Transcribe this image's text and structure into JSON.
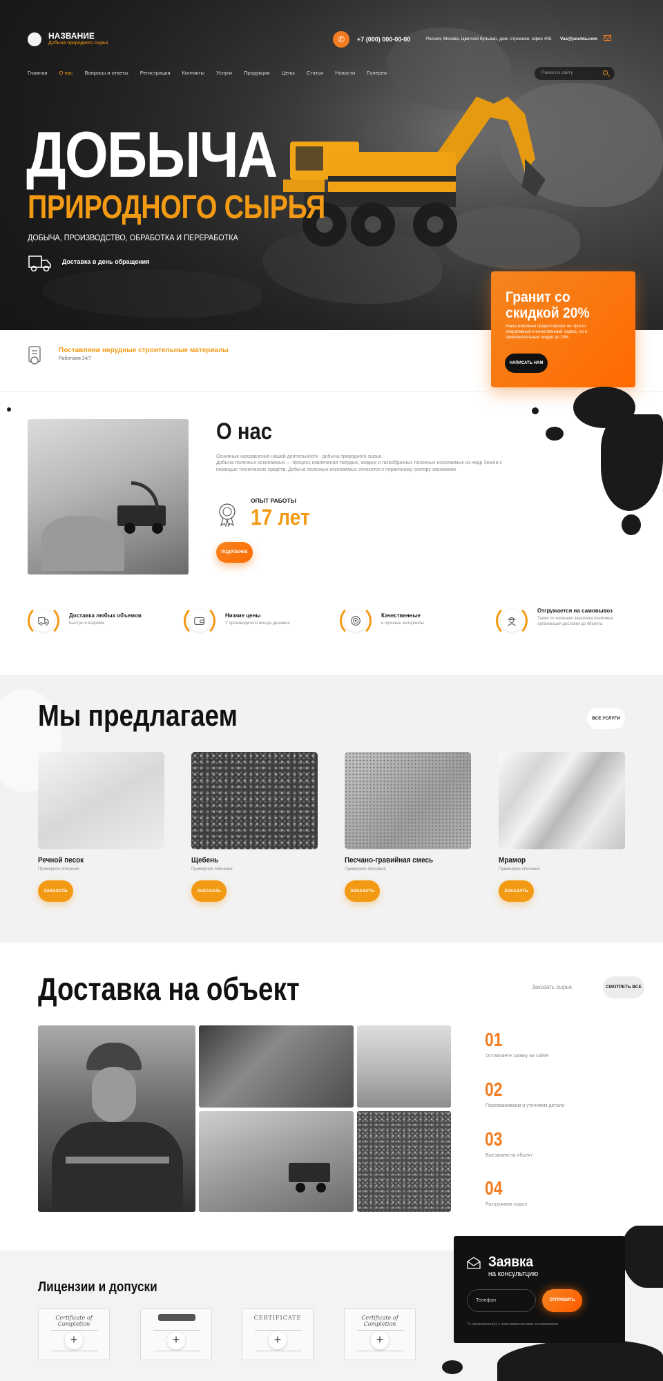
{
  "header": {
    "logo_name": "НАЗВАНИЕ",
    "logo_sub": "Добыча природного сырья",
    "phone": "+7 (000) 000-00-00",
    "address": "Россия, Москва, Цветной бульвар, дом, строение, офис 405",
    "email": "Vas@pochta.com"
  },
  "nav": {
    "items": [
      "Главная",
      "О нас",
      "Вопросы и ответы",
      "Регистрация",
      "Контакты",
      "Услуги",
      "Продукция",
      "Цены",
      "Статьи",
      "Новости",
      "Галерея"
    ],
    "active": "О нас",
    "search_placeholder": "Поиск по сайту"
  },
  "hero": {
    "title_line1": "ДОБЫЧА",
    "title_line2": "ПРИРОДНОГО СЫРЬЯ",
    "subtitle": "ДОБЫЧА, ПРОИЗВОДСТВО, ОБРАБОТКА И ПЕРЕРАБОТКА",
    "delivery": "Доставка в день обращения"
  },
  "promo": {
    "title": "Гранит со скидкой 20%",
    "text": "Наша компания предоставляет не просто оперативный и качественный сервис, но и привлекательные скидки до 20%",
    "button": "НАПИСАТЬ НАМ"
  },
  "strip": {
    "title": "Поставляем нерудные строительные материалы",
    "sub": "Работаем 24/7"
  },
  "about": {
    "title": "О нас",
    "text1": "Основные направления нашей деятельности - добыча природного сырья.",
    "text2": "Добыча полезных ископаемых — процесс извлечения твёрдых, жидких и газообразных полезных ископаемых из недр Земли с помощью технических средств. Добыча полезных ископаемых относится к первичному сектору экономики.",
    "exp_label": "ОПЫТ РАБОТЫ",
    "exp_value": "17 лет",
    "button": "ПОДРОБНЕЕ"
  },
  "features": [
    {
      "title": "Доставка любых объемов",
      "sub": "Быстро и вовремя",
      "icon": "truck-icon"
    },
    {
      "title": "Низкие цены",
      "sub": "У производителя всегда дешевле",
      "icon": "wallet-icon"
    },
    {
      "title": "Качественные",
      "sub": "и прочные материалы",
      "icon": "target-icon"
    },
    {
      "title": "Отгружается на самовывоз",
      "sub": "Также по желанию заказчика возможна организация доставки до объекта",
      "icon": "worker-icon"
    }
  ],
  "offer": {
    "title": "Мы предлагаем",
    "all_button": "ВСЕ УСЛУГИ",
    "products": [
      {
        "name": "Речной песок",
        "desc": "Примерное описание",
        "button": "ЗАКАЗАТЬ"
      },
      {
        "name": "Щебень",
        "desc": "Примерное описание",
        "button": "ЗАКАЗАТЬ"
      },
      {
        "name": "Песчано-гравийная смесь",
        "desc": "Примерное описание",
        "button": "ЗАКАЗАТЬ"
      },
      {
        "name": "Мрамор",
        "desc": "Примерное описание",
        "button": "ЗАКАЗАТЬ"
      }
    ]
  },
  "delivery": {
    "title": "Доставка на объект",
    "order_link": "Заказать сырье",
    "look_button": "СМОТРЕТЬ ВСЕ",
    "steps": [
      {
        "num": "01",
        "text": "Оставляете заявку на сайте"
      },
      {
        "num": "02",
        "text": "Перезваниваем и уточняем детали"
      },
      {
        "num": "03",
        "text": "Выезжаем на объект"
      },
      {
        "num": "04",
        "text": "Разгружаем сырье"
      }
    ]
  },
  "licenses": {
    "title": "Лицензии и допуски",
    "certs": [
      "Certificate of Completion",
      "",
      "CERTIFICATE",
      "Certificate of Completion"
    ]
  },
  "form": {
    "title": "Заявка",
    "sub": "на консультцию",
    "placeholder": "Телефон",
    "button": "ОТПРАВИТЬ",
    "note": "Я ознакомлен(а) с пользовательским соглашением"
  },
  "colors": {
    "accent": "#f39a14",
    "accent_dark": "#f47c20",
    "dark": "#111111"
  }
}
